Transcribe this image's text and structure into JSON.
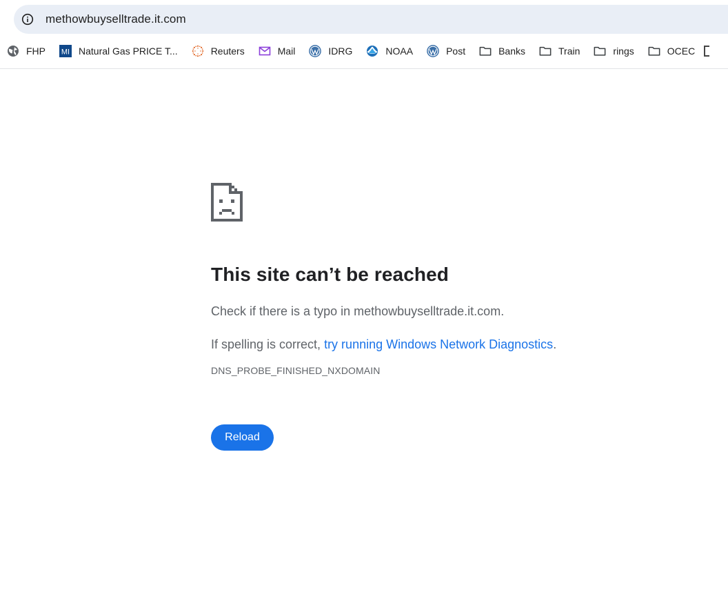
{
  "address_bar": {
    "url": "methowbuyselltrade.it.com",
    "icon": "info-icon"
  },
  "bookmarks": [
    {
      "label": "FHP",
      "icon": "globe-icon"
    },
    {
      "label": "Natural Gas PRICE T...",
      "icon": "mi-logo-icon"
    },
    {
      "label": "Reuters",
      "icon": "reuters-logo-icon"
    },
    {
      "label": "Mail",
      "icon": "mail-icon"
    },
    {
      "label": "IDRG",
      "icon": "wordpress-icon"
    },
    {
      "label": "NOAA",
      "icon": "noaa-logo-icon"
    },
    {
      "label": "Post",
      "icon": "wordpress-icon"
    },
    {
      "label": "Banks",
      "icon": "folder-icon"
    },
    {
      "label": "Train",
      "icon": "folder-icon"
    },
    {
      "label": "rings",
      "icon": "folder-icon"
    },
    {
      "label": "OCEC",
      "icon": "folder-icon"
    }
  ],
  "mi_logo_text": "MI",
  "error": {
    "icon": "sad-page-icon",
    "title": "This site can’t be reached",
    "line1": "Check if there is a typo in methowbuyselltrade.it.com.",
    "line2_prefix": "If spelling is correct, ",
    "line2_link": "try running Windows Network Diagnostics",
    "line2_suffix": ".",
    "code": "DNS_PROBE_FINISHED_NXDOMAIN",
    "reload_label": "Reload"
  },
  "colors": {
    "accent": "#1a73e8",
    "omnibox_bg": "#e9eef6",
    "text_secondary": "#5f6368"
  }
}
